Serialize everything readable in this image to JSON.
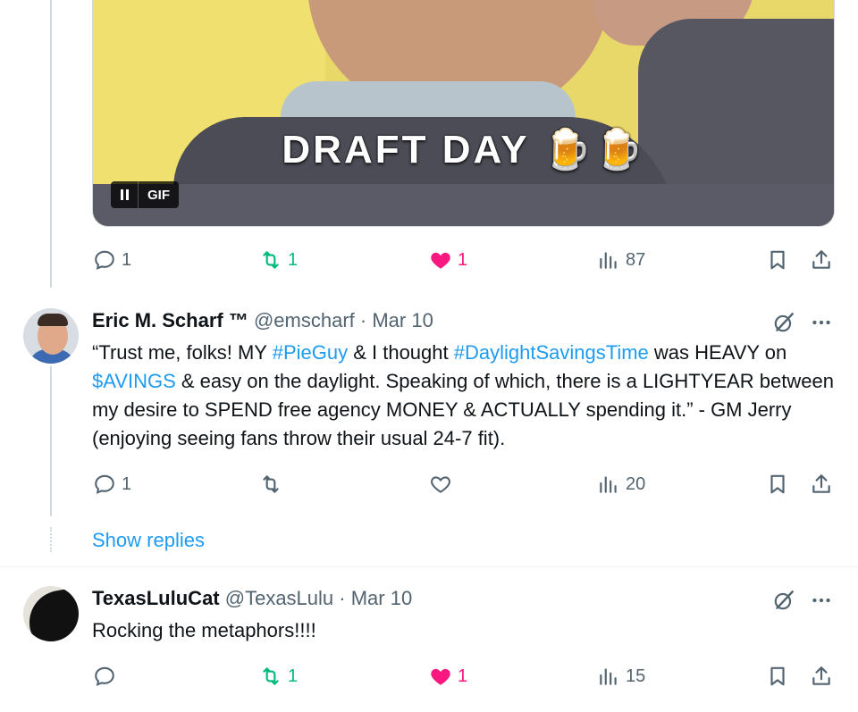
{
  "tweet1": {
    "media": {
      "caption": "DRAFT DAY 🍺🍺",
      "badge": "GIF"
    },
    "actions": {
      "replies": "1",
      "retweets": "1",
      "likes": "1",
      "views": "87"
    }
  },
  "tweet2": {
    "name": "Eric M. Scharf ™",
    "handle": "@emscharf",
    "date": "Mar 10",
    "text_parts": {
      "t1": "“Trust me, folks! MY ",
      "h1": "#PieGuy",
      "t2": " & I thought ",
      "h2": "#DaylightSavingsTime",
      "t3": " was HEAVY on ",
      "h3": "$AVINGS",
      "t4": " & easy on the daylight. Speaking of which, there is a LIGHTYEAR between my desire to SPEND free agency MONEY & ACTUALLY spending it.” - GM Jerry (enjoying seeing fans throw their usual 24-7 fit)."
    },
    "actions": {
      "replies": "1",
      "retweets": "",
      "likes": "",
      "views": "20"
    }
  },
  "show_replies": "Show replies",
  "tweet3": {
    "name": "TexasLuluCat",
    "handle": "@TexasLulu",
    "date": "Mar 10",
    "text": "Rocking the metaphors!!!!",
    "actions": {
      "replies": "",
      "retweets": "1",
      "likes": "1",
      "views": "15"
    }
  },
  "colors": {
    "retweet": "#00ba7c",
    "like": "#f91880",
    "link": "#1d9bf0",
    "muted": "#536471"
  }
}
